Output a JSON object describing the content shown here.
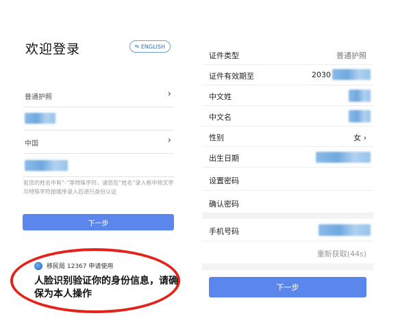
{
  "left": {
    "title": "欢迎登录",
    "lang_button": "ENGLISH",
    "lang_icon": "globe-icon",
    "fields": [
      {
        "value": "普通护照",
        "chevron": "›"
      },
      {
        "value": "中国",
        "chevron": "›"
      }
    ],
    "hint": "若您的姓名中有“-”等特殊字符，请您在“姓名”录入框中将文字与特殊字符按顺序录入后进行身份认证",
    "next_button": "下一步",
    "agency": "移民局 12367 申请使用",
    "face_message": "人脸识别验证你的身份信息，请确保为本人操作"
  },
  "right": {
    "rows": [
      {
        "label": "证件类型",
        "value": "普通护照"
      },
      {
        "label": "证件有效期至",
        "value": "2030"
      },
      {
        "label": "中文姓",
        "value": ""
      },
      {
        "label": "中文名",
        "value": ""
      },
      {
        "label": "性别",
        "value": "女 ›"
      },
      {
        "label": "出生日期",
        "value": ""
      },
      {
        "label": "设置密码",
        "value": ""
      },
      {
        "label": "确认密码",
        "value": ""
      },
      {
        "label": "手机号码",
        "value": ""
      }
    ],
    "resend": "重新获取(44s)",
    "next_button": "下一步"
  },
  "colors": {
    "accent": "#5b86ec",
    "highlight_oval": "#e3221c",
    "link": "#2e6fbf"
  }
}
